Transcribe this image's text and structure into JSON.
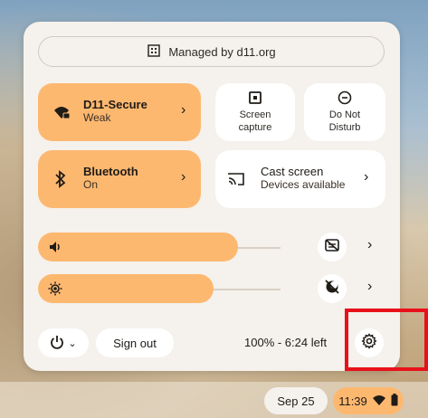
{
  "managed": {
    "label": "Managed by d11.org",
    "icon": "building-icon"
  },
  "network": {
    "title": "D11-Secure",
    "subtitle": "Weak",
    "icon": "wifi-lock-icon"
  },
  "screen_capture": {
    "line1": "Screen",
    "line2": "capture",
    "icon": "screen-capture-icon"
  },
  "dnd": {
    "line1": "Do Not",
    "line2": "Disturb",
    "icon": "do-not-disturb-icon"
  },
  "bluetooth": {
    "title": "Bluetooth",
    "subtitle": "On",
    "icon": "bluetooth-icon"
  },
  "cast": {
    "title": "Cast screen",
    "subtitle": "Devices available",
    "icon": "cast-icon"
  },
  "volume": {
    "level": 0.82,
    "icon": "volume-icon"
  },
  "brightness": {
    "level": 0.72,
    "icon": "brightness-icon"
  },
  "footer": {
    "sign_out": "Sign out",
    "battery": "100% - 6:24 left"
  },
  "shelf": {
    "date": "Sep 25",
    "time": "11:39"
  },
  "colors": {
    "accent": "#fdb870",
    "panel": "#f5f1ec",
    "highlight": "#e8111a"
  }
}
